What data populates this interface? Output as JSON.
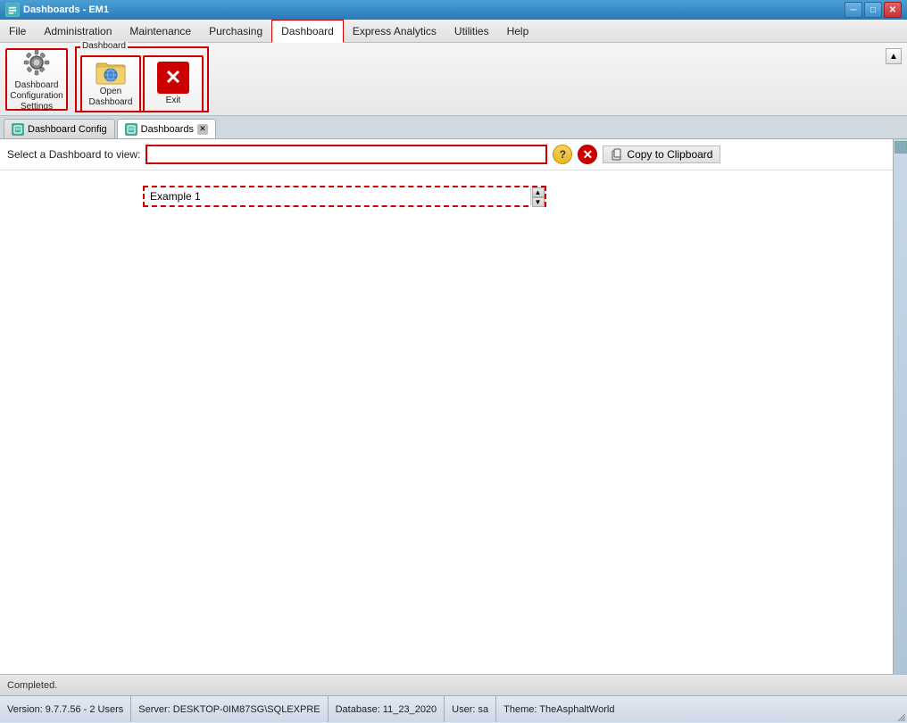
{
  "titleBar": {
    "title": "Dashboards - EM1",
    "icon": "D"
  },
  "menuBar": {
    "items": [
      {
        "label": "File",
        "active": false
      },
      {
        "label": "Administration",
        "active": false
      },
      {
        "label": "Maintenance",
        "active": false
      },
      {
        "label": "Purchasing",
        "active": false
      },
      {
        "label": "Dashboard",
        "active": true
      },
      {
        "label": "Express Analytics",
        "active": false
      },
      {
        "label": "Utilities",
        "active": false
      },
      {
        "label": "Help",
        "active": false
      }
    ]
  },
  "toolbar": {
    "buttons": [
      {
        "id": "dashboard-config",
        "label": "Dashboard\nConfiguration\nSettings",
        "iconType": "gear"
      },
      {
        "id": "open-dashboard",
        "label": "Open\nDashboard",
        "group": "Dashboard",
        "iconType": "folder"
      },
      {
        "id": "exit",
        "label": "Exit",
        "iconType": "exit"
      }
    ],
    "groups": [
      {
        "label": "Dashboard",
        "start": 1,
        "end": 1
      }
    ]
  },
  "tabs": [
    {
      "label": "Dashboard Config",
      "active": false,
      "closeable": false
    },
    {
      "label": "Dashboards",
      "active": true,
      "closeable": true
    }
  ],
  "dashboardView": {
    "selectLabel": "Select a Dashboard to view:",
    "selectValue": "",
    "selectPlaceholder": "",
    "dropdownItems": [
      "Example 1"
    ],
    "helpButton": "?",
    "copyButton": "Copy to Clipboard"
  },
  "statusBar": {
    "text": "Completed."
  },
  "bottomBar": {
    "version": "Version: 9.7.7.56 - 2 Users",
    "server": "Server: DESKTOP-0IM87SG\\SQLEXPRE",
    "database": "Database: 11_23_2020",
    "user": "User: sa",
    "theme": "Theme: TheAsphaltWorld"
  }
}
